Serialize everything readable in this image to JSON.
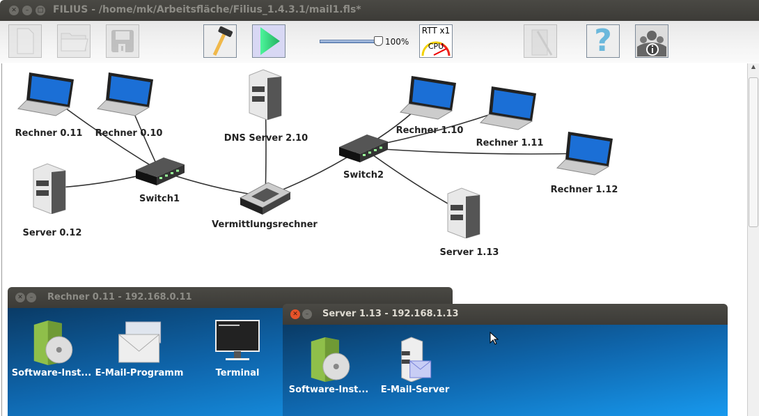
{
  "window": {
    "title": "FILIUS - /home/mk/Arbeitsfläche/Filius_1.4.3.1/mail1.fls*"
  },
  "toolbar": {
    "zoom_label": "100%",
    "zoom_value": 100,
    "rtt_label": "RTT x1",
    "cpu_label": "CPU",
    "buttons": [
      {
        "icon": "new-file-icon",
        "enabled": false
      },
      {
        "icon": "open-folder-icon",
        "enabled": false
      },
      {
        "icon": "save-icon",
        "enabled": false
      },
      {
        "icon": "hammer-icon",
        "enabled": true
      },
      {
        "icon": "play-icon",
        "enabled": true
      },
      {
        "icon": "wizard-icon",
        "enabled": false
      },
      {
        "icon": "help-icon",
        "enabled": true
      },
      {
        "icon": "info-icon",
        "enabled": true
      }
    ]
  },
  "network": {
    "nodes": [
      {
        "id": "r011",
        "label": "Rechner 0.11",
        "type": "laptop"
      },
      {
        "id": "r010",
        "label": "Rechner 0.10",
        "type": "laptop"
      },
      {
        "id": "s012",
        "label": "Server 0.12",
        "type": "server"
      },
      {
        "id": "sw1",
        "label": "Switch1",
        "type": "switch"
      },
      {
        "id": "dns",
        "label": "DNS Server 2.10",
        "type": "server"
      },
      {
        "id": "vr",
        "label": "Vermittlungsrechner",
        "type": "router"
      },
      {
        "id": "sw2",
        "label": "Switch2",
        "type": "switch"
      },
      {
        "id": "r110",
        "label": "Rechner 1.10",
        "type": "laptop"
      },
      {
        "id": "r111",
        "label": "Rechner 1.11",
        "type": "laptop"
      },
      {
        "id": "r112",
        "label": "Rechner 1.12",
        "type": "laptop"
      },
      {
        "id": "s113",
        "label": "Server 1.13",
        "type": "server"
      }
    ],
    "cables": [
      [
        "r011",
        "sw1"
      ],
      [
        "r010",
        "sw1"
      ],
      [
        "s012",
        "sw1"
      ],
      [
        "sw1",
        "vr"
      ],
      [
        "dns",
        "vr"
      ],
      [
        "vr",
        "sw2"
      ],
      [
        "sw2",
        "r110"
      ],
      [
        "sw2",
        "r111"
      ],
      [
        "sw2",
        "r112"
      ],
      [
        "sw2",
        "s113"
      ]
    ]
  },
  "desktop_windows": [
    {
      "title": "Rechner 0.11 - 192.168.0.11",
      "apps": [
        {
          "label": "Software-Inst...",
          "icon": "software-installer-icon"
        },
        {
          "label": "E-Mail-Programm",
          "icon": "email-client-icon"
        },
        {
          "label": "Terminal",
          "icon": "terminal-icon"
        }
      ]
    },
    {
      "title": "Server 1.13 - 192.168.1.13",
      "apps": [
        {
          "label": "Software-Inst...",
          "icon": "software-installer-icon"
        },
        {
          "label": "E-Mail-Server",
          "icon": "email-server-icon"
        }
      ]
    }
  ]
}
